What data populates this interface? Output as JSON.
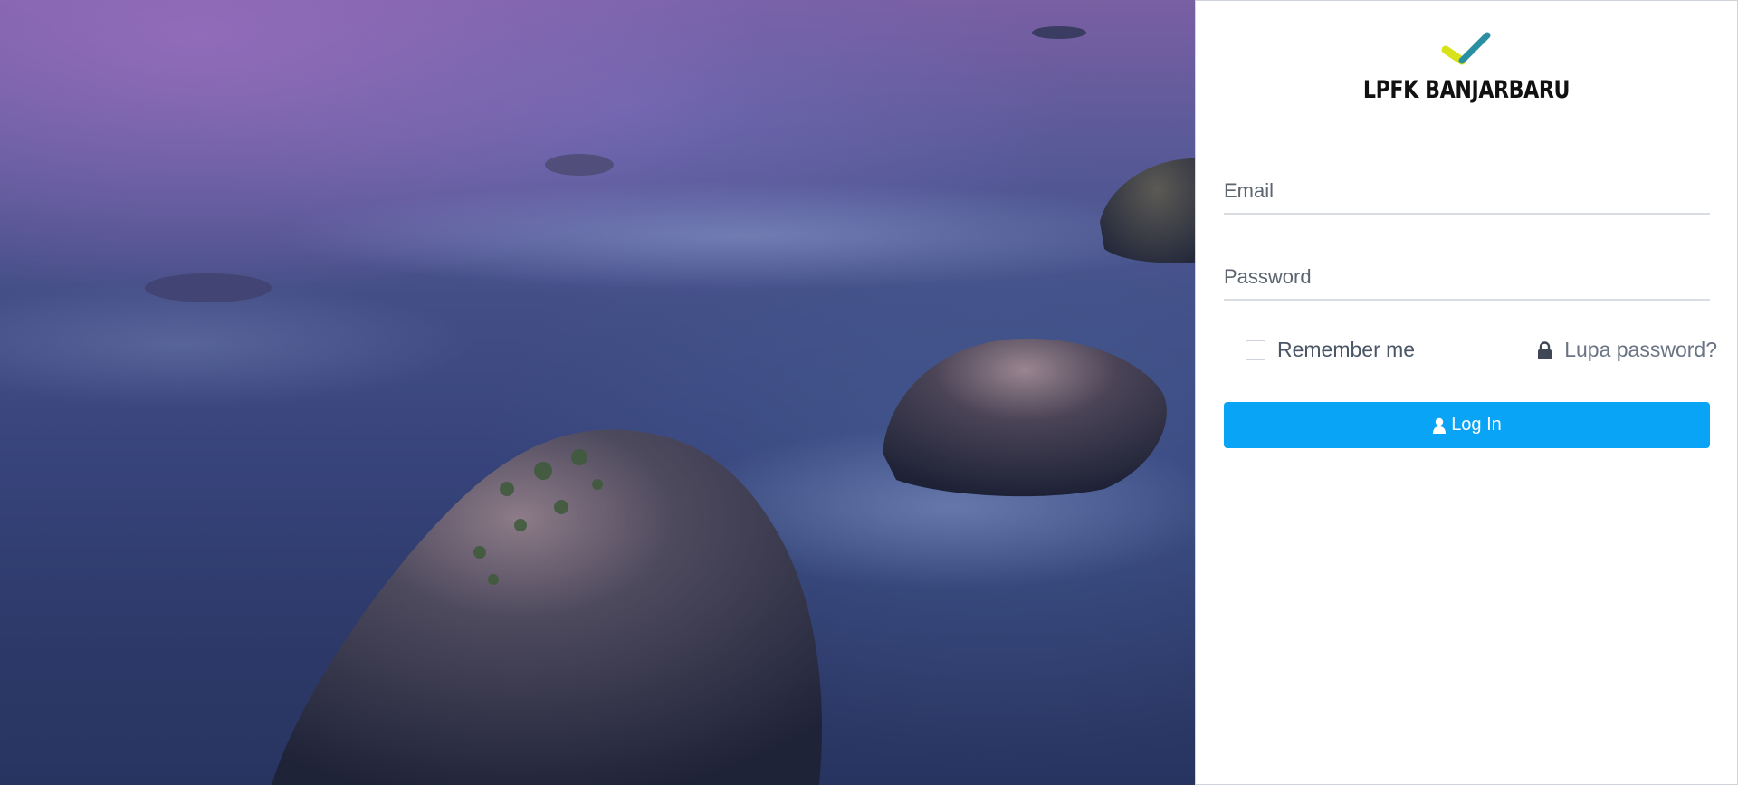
{
  "brand": {
    "name": "LPFK BANJARBARU",
    "accent_colors": [
      "#d7e21b",
      "#2a8fa0"
    ]
  },
  "form": {
    "email_placeholder": "Email",
    "password_placeholder": "Password",
    "remember_label": "Remember me",
    "remember_checked": false,
    "forgot_label": "Lupa password?",
    "forgot_icon": "lock-icon",
    "login_label": "Log In",
    "login_icon": "user-icon"
  },
  "colors": {
    "primary_button": "#0aa4f6",
    "panel_background": "#ffffff"
  }
}
